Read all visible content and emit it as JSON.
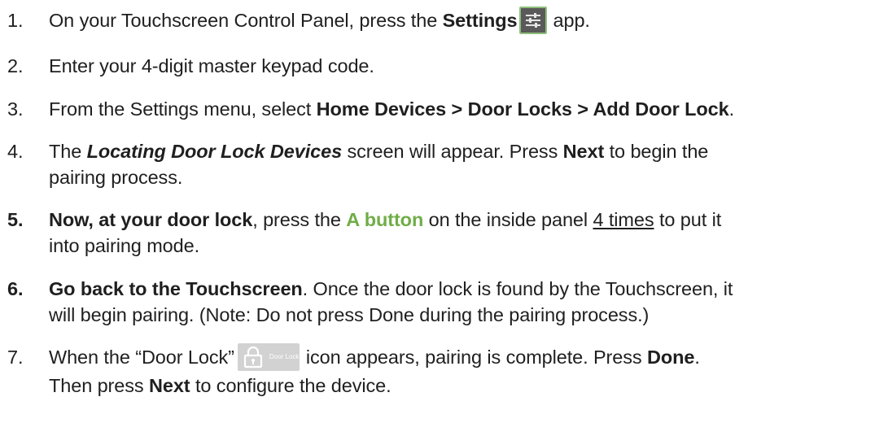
{
  "steps": [
    {
      "num": "1.",
      "lines": [
        {
          "pre": "On your Touchscreen Control Panel, press the ",
          "bold": "Settings",
          "post": "app."
        }
      ]
    },
    {
      "num": "2.",
      "lines": [
        {
          "text": "Enter your 4-digit master keypad code."
        }
      ]
    },
    {
      "num": "3.",
      "lines": [
        {
          "pre": "From the Settings menu, select ",
          "bold": "Home Devices > Door Locks > Add Door Lock",
          "post": "."
        }
      ]
    },
    {
      "num": "4.",
      "lines": [
        {
          "pre": "The ",
          "bold_italic": "Locating Door Lock Devices",
          "mid": " screen will appear. Press ",
          "bold": "Next",
          "post": " to begin the"
        },
        {
          "text": "pairing process."
        }
      ]
    },
    {
      "num": "5.",
      "lines": [
        {
          "bold": "Now, at your door lock",
          "mid": ", press the ",
          "green": "A button",
          "mid2": " on the inside panel ",
          "underline": "4 times",
          "post": " to put it"
        },
        {
          "text": "into pairing mode."
        }
      ]
    },
    {
      "num": "6.",
      "lines": [
        {
          "bold": "Go back to the Touchscreen",
          "post": ". Once the door lock is found by the Touchscreen, it"
        },
        {
          "text": "will begin pairing. (Note: Do not press Done during the pairing process.)"
        }
      ]
    },
    {
      "num": "7.",
      "lines": [
        {
          "pre": "When the “Door Lock”",
          "icon_label": "Door Lock",
          "mid": "icon appears, pairing is complete. Press ",
          "bold": "Done",
          "post": "."
        },
        {
          "pre": "Then press ",
          "bold": "Next",
          "post": " to configure the device."
        }
      ]
    }
  ],
  "icons": {
    "settings": "sliders-settings-icon",
    "door_lock": "padlock-icon"
  },
  "colors": {
    "text": "#1f1f1f",
    "highlight_green": "#70ad47",
    "settings_icon_bg": "#5a5a5a",
    "door_lock_icon_bg": "#d2d2d2"
  }
}
